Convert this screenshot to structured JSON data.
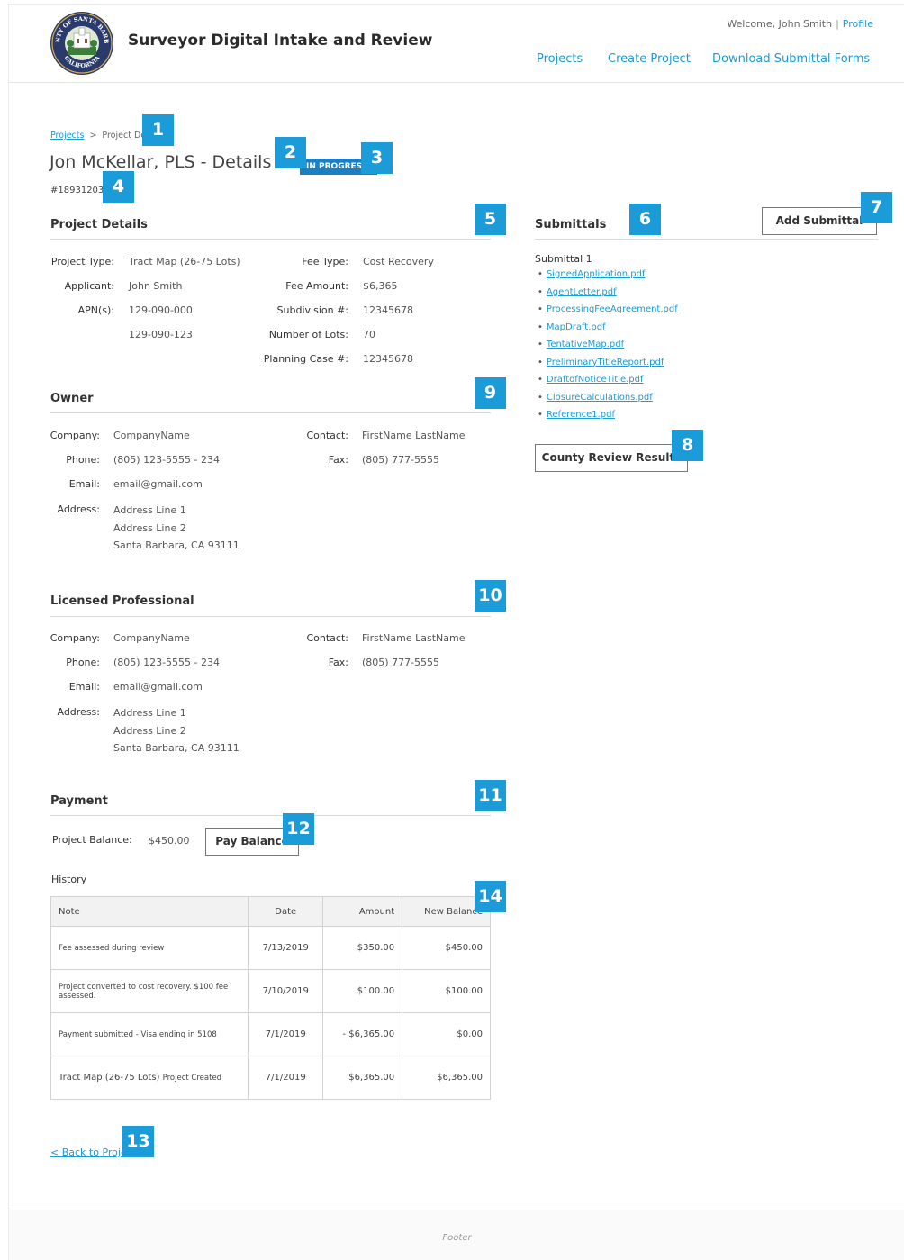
{
  "header": {
    "seal_text_top": "COUNTY OF SANTA BARBARA",
    "seal_text_bottom": "CALIFORNIA",
    "app_title": "Surveyor Digital Intake and Review",
    "welcome": "Welcome, John Smith",
    "profile": "Profile",
    "nav": [
      "Projects",
      "Create Project",
      "Download Submittal Forms"
    ]
  },
  "breadcrumb": {
    "root": "Projects",
    "separator": ">",
    "current": "Project De"
  },
  "page_title": "Jon McKellar, PLS - Details",
  "status": "IN PROGRESS",
  "project_id": "#18931203",
  "project_details": {
    "title": "Project Details",
    "left": [
      {
        "label": "Project Type:",
        "value": "Tract Map (26-75 Lots)"
      },
      {
        "label": "Applicant:",
        "value": "John Smith"
      },
      {
        "label": "APN(s):",
        "value": "129-090-000"
      },
      {
        "label": "",
        "value": "129-090-123"
      }
    ],
    "right": [
      {
        "label": "Fee Type:",
        "value": "Cost Recovery"
      },
      {
        "label": "Fee Amount:",
        "value": "$6,365"
      },
      {
        "label": "Subdivision #:",
        "value": "12345678"
      },
      {
        "label": "Number of Lots:",
        "value": "70"
      },
      {
        "label": "Planning Case #:",
        "value": "12345678"
      }
    ]
  },
  "owner": {
    "title": "Owner",
    "company_label": "Company:",
    "company": "CompanyName",
    "contact_label": "Contact:",
    "contact": "FirstName LastName",
    "phone_label": "Phone:",
    "phone": "(805) 123-5555 - 234",
    "fax_label": "Fax:",
    "fax": "(805) 777-5555",
    "email_label": "Email:",
    "email": "email@gmail.com",
    "address_label": "Address:",
    "address": [
      "Address Line 1",
      "Address Line 2",
      "Santa Barbara, CA 93111"
    ]
  },
  "licensed_professional": {
    "title": "Licensed Professional",
    "company_label": "Company:",
    "company": "CompanyName",
    "contact_label": "Contact:",
    "contact": "FirstName LastName",
    "phone_label": "Phone:",
    "phone": "(805) 123-5555 - 234",
    "fax_label": "Fax:",
    "fax": "(805) 777-5555",
    "email_label": "Email:",
    "email": "email@gmail.com",
    "address_label": "Address:",
    "address": [
      "Address Line 1",
      "Address Line 2",
      "Santa Barbara, CA 93111"
    ]
  },
  "payment": {
    "title": "Payment",
    "balance_label": "Project Balance:",
    "balance": "$450.00",
    "pay_button": "Pay Balance",
    "history_label": "History",
    "columns": [
      "Note",
      "Date",
      "Amount",
      "New Balance"
    ],
    "rows": [
      {
        "note": "Fee assessed during review",
        "date": "7/13/2019",
        "amount": "$350.00",
        "balance": "$450.00"
      },
      {
        "note": "Project converted to cost recovery.  $100 fee assessed.",
        "date": "7/10/2019",
        "amount": "$100.00",
        "balance": "$100.00"
      },
      {
        "note": "Payment submitted - Visa ending in 5108",
        "date": "7/1/2019",
        "amount": "- $6,365.00",
        "balance": "$0.00"
      },
      {
        "note_main": "Tract Map (26-75 Lots)",
        "note_suffix": "Project Created",
        "date": "7/1/2019",
        "amount": "$6,365.00",
        "balance": "$6,365.00"
      }
    ]
  },
  "submittals": {
    "title": "Submittals",
    "add_button": "Add Submittal",
    "submittal_label": "Submittal 1",
    "files": [
      "SignedApplication.pdf",
      "AgentLetter.pdf",
      "ProcessingFeeAgreement.pdf",
      "MapDraft.pdf",
      "TentativeMap.pdf",
      "PreliminaryTitleReport.pdf",
      "DraftofNoticeTitle.pdf",
      "ClosureCalculations.pdf",
      "Reference1.pdf"
    ],
    "review_button": "County Review Results"
  },
  "back_link": "< Back to Proje",
  "footer": "Footer",
  "annotations": [
    "1",
    "2",
    "3",
    "4",
    "5",
    "6",
    "7",
    "8",
    "9",
    "10",
    "11",
    "12",
    "13",
    "14"
  ],
  "colors": {
    "accent": "#1b9bd8",
    "status": "#1b7fc4",
    "badge": "#1b9bd8",
    "seal_green": "#3c7d3a",
    "seal_navy": "#2a3a6c",
    "seal_gold": "#d7b14a"
  }
}
